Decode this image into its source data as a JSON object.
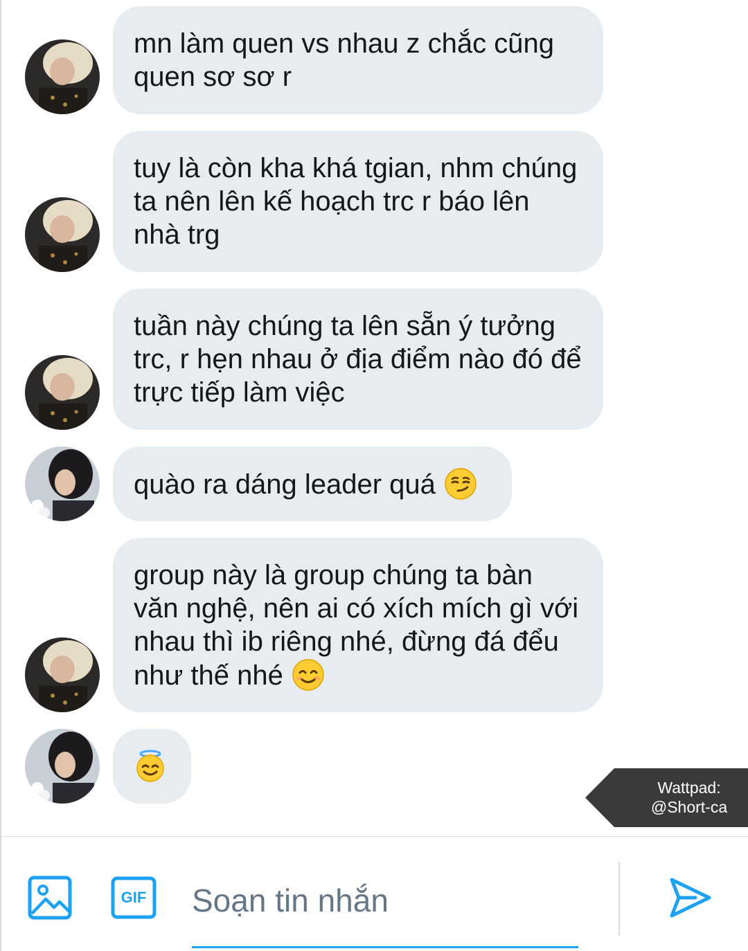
{
  "messages": [
    {
      "text": "mn làm quen vs nhau z chắc cũng quen sơ sơ r",
      "emoji": null,
      "avatar": "avatar-user-blonde"
    },
    {
      "text": "tuy là còn kha khá tgian, nhm chúng ta nên lên kế hoạch trc r báo lên nhà trg",
      "emoji": null,
      "avatar": "avatar-user-blonde"
    },
    {
      "text": "tuần này chúng ta lên sẵn ý tưởng trc, r hẹn nhau ở địa điểm nào đó để trực tiếp làm việc",
      "emoji": null,
      "avatar": "avatar-user-blonde"
    },
    {
      "text": "quào ra dáng leader quá",
      "emoji": "smirking-face",
      "avatar": "avatar-user-darkhair"
    },
    {
      "text": "group này là group chúng ta bàn văn nghệ, nên ai có xích mích gì với nhau thì ib riêng nhé, đừng đá đểu như thế nhé",
      "emoji": "smiling-face-with-smiling-eyes",
      "avatar": "avatar-user-blonde"
    },
    {
      "text": "",
      "emoji": "smiling-face-with-halo",
      "avatar": "avatar-user-darkhair"
    }
  ],
  "watermark": {
    "line1": "Wattpad:",
    "line2": "@Short-ca"
  },
  "composer": {
    "placeholder": "Soạn tin nhắn",
    "gif_label": "GIF",
    "image_icon": "image-icon",
    "send_icon": "send-icon"
  },
  "colors": {
    "bubble": "#e6ecf0",
    "accent": "#1da1f2",
    "text": "#14171a",
    "placeholder": "#657786",
    "watermark_bg": "#3a3a3a"
  }
}
